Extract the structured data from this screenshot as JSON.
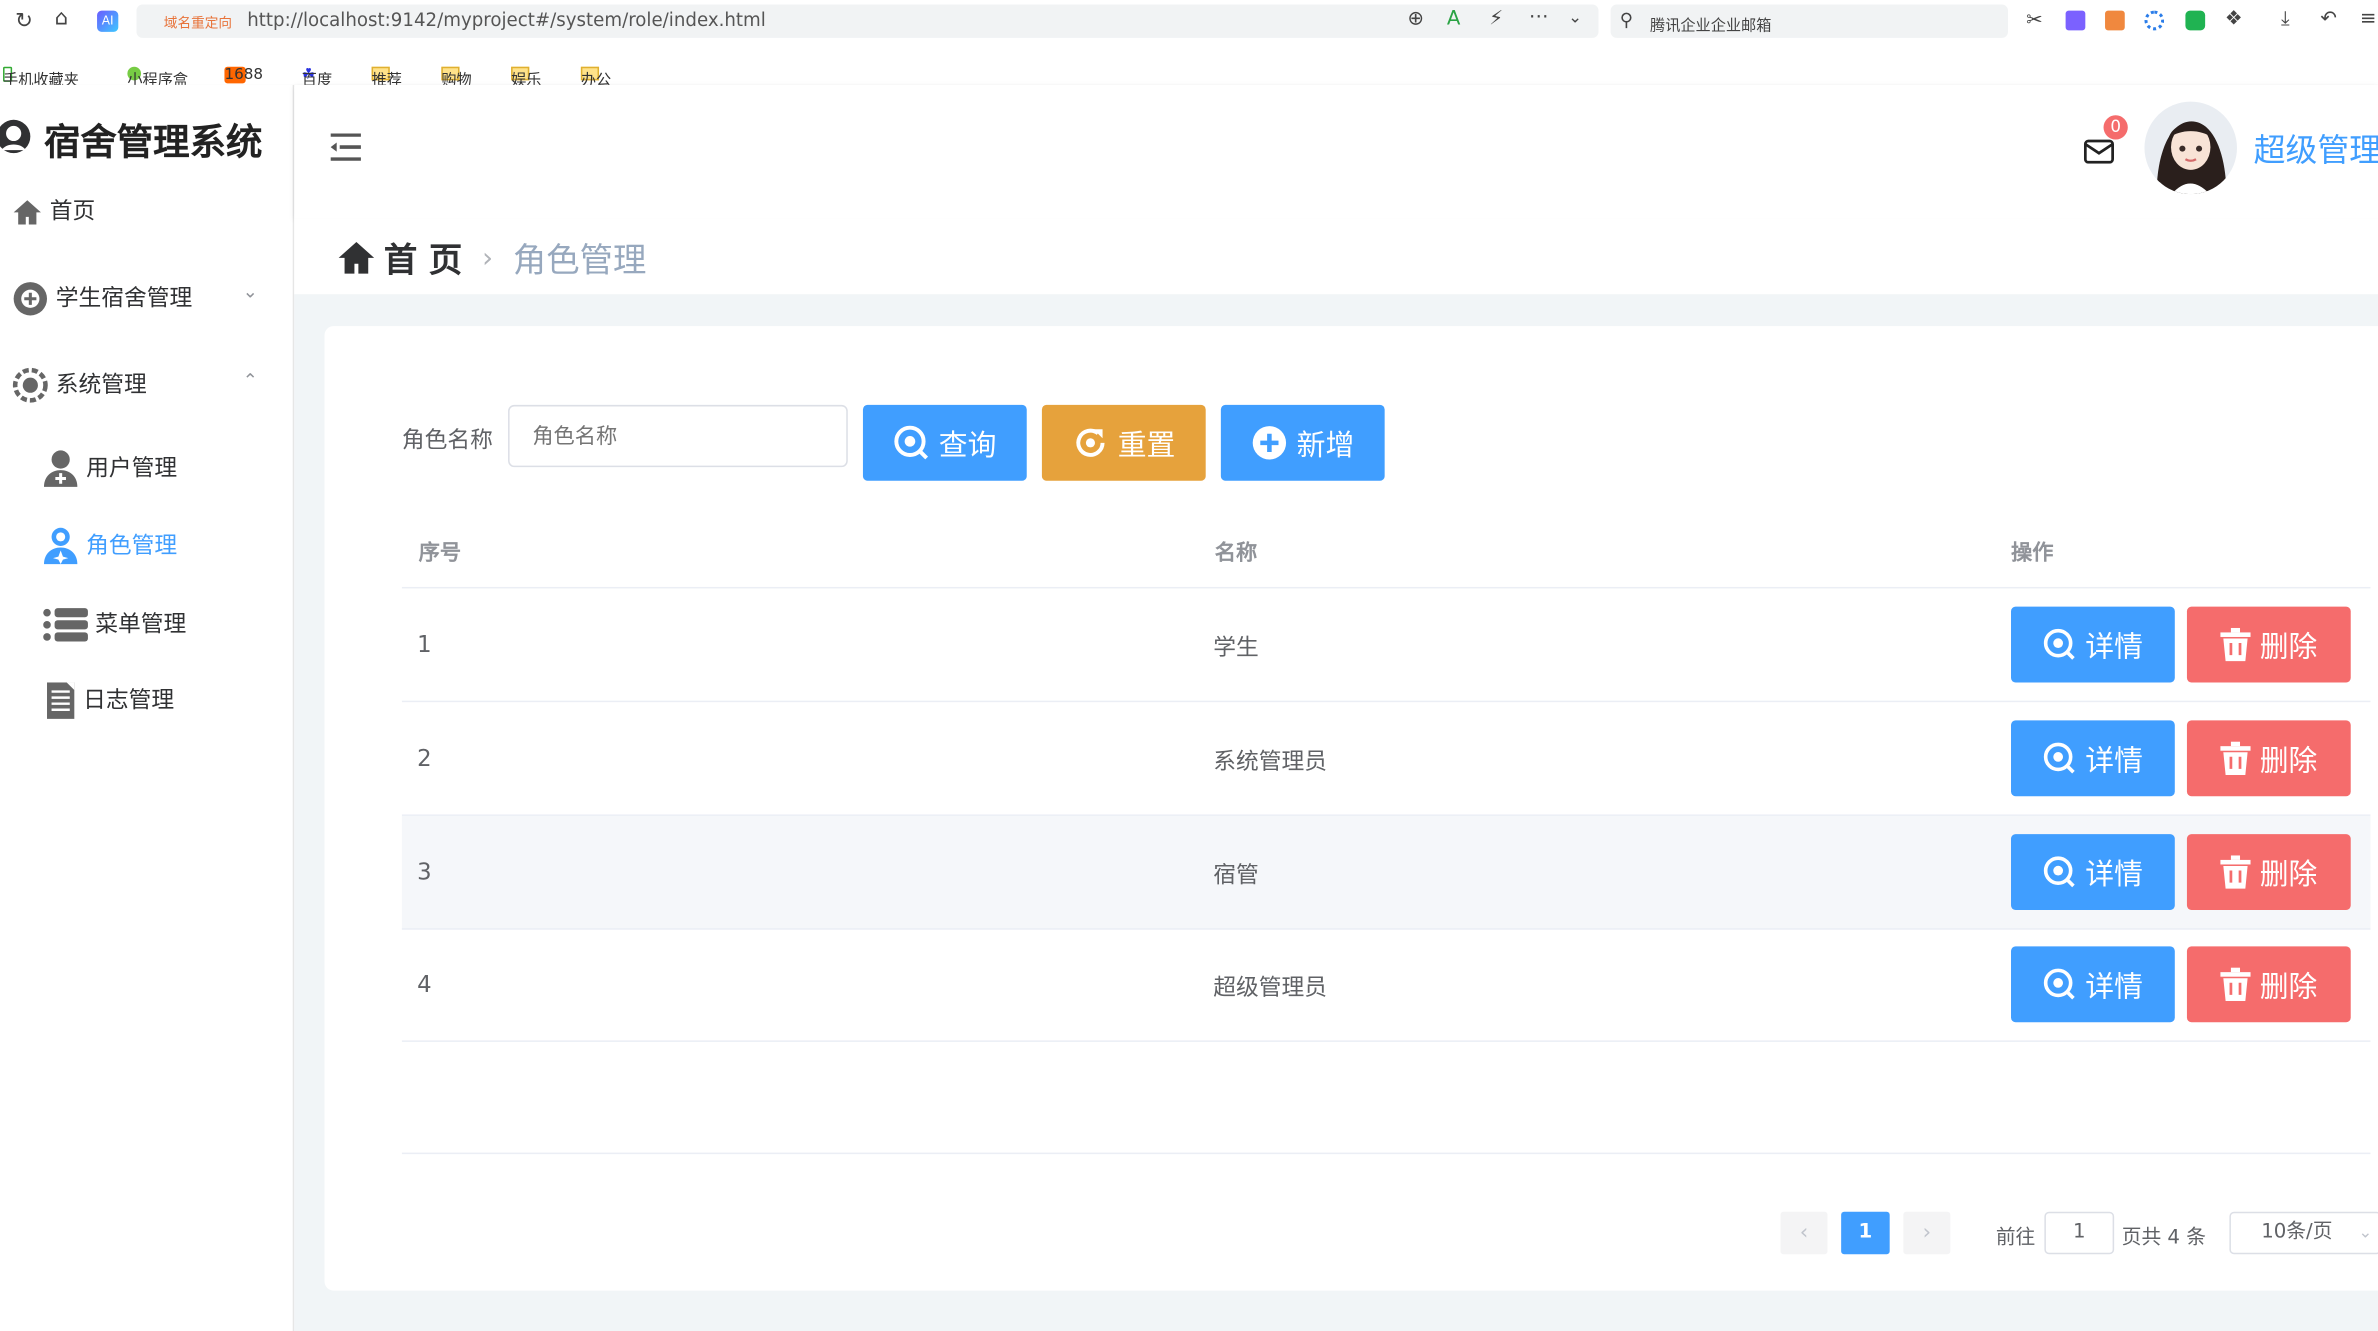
{
  "browser": {
    "redirect_tag": "域名重定向",
    "url": "http://localhost:9142/myproject#/system/role/index.html",
    "search_text": "腾讯企业企业邮箱",
    "bookmarks": [
      "手机收藏夹",
      "小程序盒",
      "1688",
      "百度",
      "推荐",
      "购物",
      "娱乐",
      "办公"
    ]
  },
  "app": {
    "title": "宿舍管理系统",
    "user_name": "超级管理",
    "mail_count": "0"
  },
  "sidebar": {
    "home": "首页",
    "student_dorm": "学生宿舍管理",
    "system": "系统管理",
    "user_mgmt": "用户管理",
    "role_mgmt": "角色管理",
    "menu_mgmt": "菜单管理",
    "log_mgmt": "日志管理"
  },
  "breadcrumb": {
    "home": "首 页",
    "current": "角色管理"
  },
  "search": {
    "label": "角色名称",
    "placeholder": "角色名称",
    "query_btn": "查询",
    "reset_btn": "重置",
    "add_btn": "新增"
  },
  "table": {
    "headers": [
      "序号",
      "名称",
      "操作"
    ],
    "rows": [
      {
        "index": "1",
        "name": "学生"
      },
      {
        "index": "2",
        "name": "系统管理员"
      },
      {
        "index": "3",
        "name": "宿管"
      },
      {
        "index": "4",
        "name": "超级管理员"
      }
    ],
    "detail_btn": "详情",
    "delete_btn": "删除"
  },
  "pagination": {
    "current_page": "1",
    "goto_label": "前往",
    "goto_value": "1",
    "total_text": "页共 4 条",
    "page_size": "10条/页"
  },
  "colors": {
    "primary": "#409eff",
    "warning": "#e6a23c",
    "danger": "#f56c6c"
  }
}
